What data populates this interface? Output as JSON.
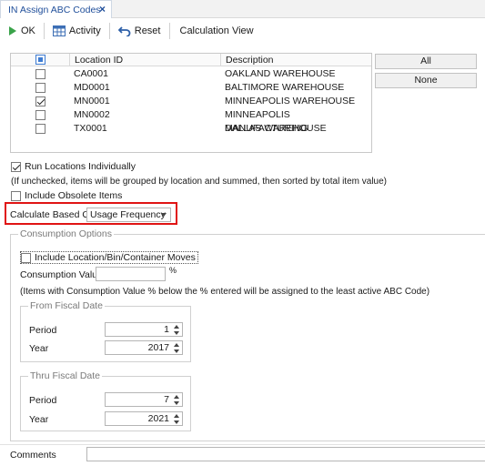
{
  "tab": {
    "title": "IN Assign ABC Codes",
    "close": "×"
  },
  "toolbar": {
    "ok_label": "OK",
    "activity_label": "Activity",
    "reset_label": "Reset",
    "calc_view_label": "Calculation View"
  },
  "grid": {
    "columns": [
      "Location ID",
      "Description"
    ],
    "rows": [
      {
        "checked": false,
        "location_id": "CA0001",
        "description": "OAKLAND WAREHOUSE"
      },
      {
        "checked": false,
        "location_id": "MD0001",
        "description": "BALTIMORE WAREHOUSE"
      },
      {
        "checked": true,
        "location_id": "MN0001",
        "description": "MINNEAPOLIS WAREHOUSE"
      },
      {
        "checked": false,
        "location_id": "MN0002",
        "description": "MINNEAPOLIS MANUFACTURING"
      },
      {
        "checked": false,
        "location_id": "TX0001",
        "description": "DALLAS WAREHOUSE"
      }
    ]
  },
  "side_buttons": {
    "all": "All",
    "none": "None"
  },
  "options": {
    "run_individually_label": "Run Locations Individually",
    "run_individually_checked": true,
    "run_note": "(If unchecked, items will be grouped by location and summed, then sorted by total item value)",
    "include_obsolete_label": "Include Obsolete Items",
    "include_obsolete_checked": false,
    "calc_based_on_label": "Calculate Based On",
    "calc_based_on_value": "Usage Frequency"
  },
  "consumption": {
    "title": "Consumption Options",
    "include_moves_label": "Include Location/Bin/Container Moves",
    "include_moves_checked": false,
    "consumption_value_label": "Consumption Value",
    "consumption_value": "",
    "percent_symbol": "%",
    "note": "(Items with Consumption Value % below the % entered will be assigned to the least active ABC Code)"
  },
  "from_fiscal": {
    "title": "From Fiscal Date",
    "period_label": "Period",
    "period": "1",
    "year_label": "Year",
    "year": "2017"
  },
  "thru_fiscal": {
    "title": "Thru Fiscal Date",
    "period_label": "Period",
    "period": "7",
    "year_label": "Year",
    "year": "2021"
  },
  "comments": {
    "label": "Comments",
    "value": ""
  },
  "colors": {
    "tab_text": "#1f4e9a",
    "ok_icon": "#3aa34a",
    "highlight_border": "#e01414",
    "checkbox_blue": "#3d7bd1"
  }
}
